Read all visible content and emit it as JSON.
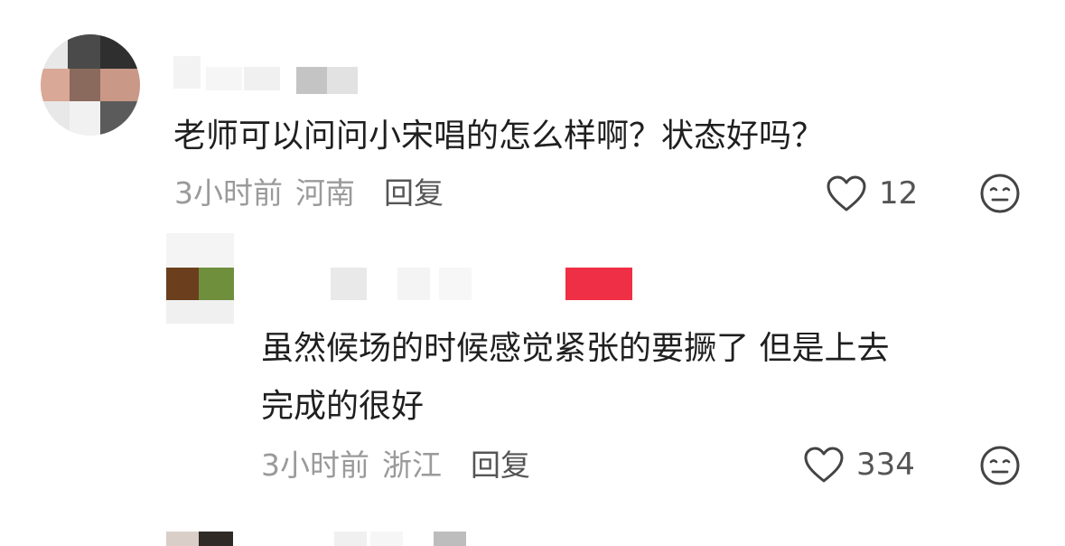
{
  "comments": [
    {
      "text": "老师可以问问小宋唱的怎么样啊？状态好吗？",
      "time": "3小时前",
      "location": "河南",
      "reply_label": "回复",
      "like_count": "12"
    },
    {
      "text_line1": "虽然候场的时候感觉紧张的要撅了 但是上去",
      "text_line2": "完成的很好",
      "time": "3小时前",
      "location": "浙江",
      "reply_label": "回复",
      "like_count": "334"
    }
  ],
  "icons": {
    "like": "heart-outline-icon",
    "dislike": "neutral-face-icon"
  },
  "colors": {
    "meta_gray": "#9a9a9a",
    "reply_gray": "#555555",
    "text": "#1f1f1f"
  }
}
